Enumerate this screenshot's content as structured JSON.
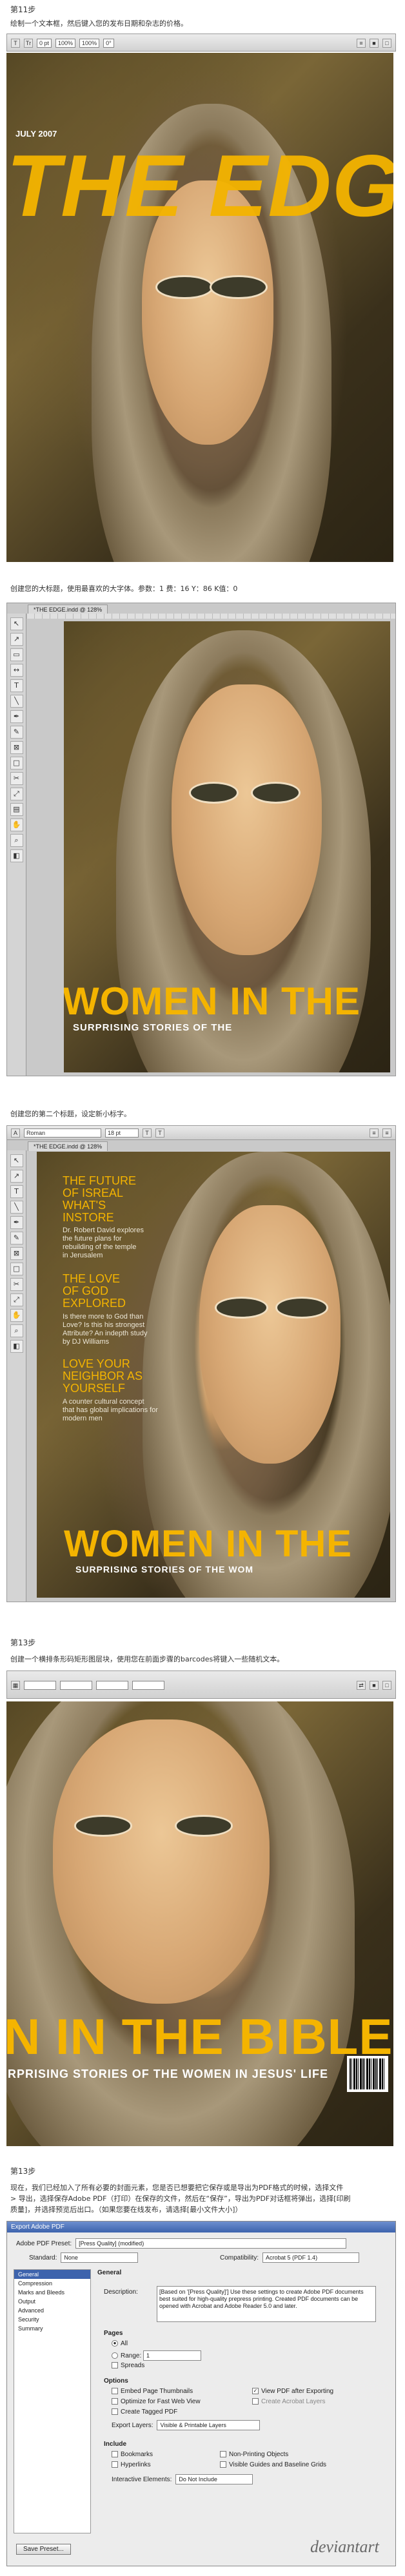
{
  "step11": {
    "heading": "第11步",
    "caption": "绘制一个文本框，然后键入您的发布日期和杂志的价格。",
    "cover_small_text": "JULY 2007",
    "cover_title": "THE EDGE",
    "toolbar": [
      "T",
      "Tr",
      "0 pt",
      "100%",
      "100%",
      "0°"
    ]
  },
  "step12": {
    "caption": "创建您的大标题，使用最喜欢的大字体。参数：1 费：16 Y：86 K值：0",
    "tab": "*THE EDGE.indd @ 128%",
    "title": "WOMEN IN THE",
    "subtitle": "SURPRISING STORIES OF THE"
  },
  "step13": {
    "caption": "创建您的第二个标题，设定新小标字。",
    "tab": "*THE EDGE.indd @ 128%",
    "font": "Roman",
    "size": "18 pt",
    "headline1": [
      "THE FUTURE",
      "OF ISREAL",
      "WHAT'S",
      "INSTORE"
    ],
    "body1": [
      "Dr. Robert David explores",
      "the future plans for",
      "rebuilding of the temple",
      "in Jerusalem"
    ],
    "headline2": [
      "THE LOVE",
      "OF GOD",
      "EXPLORED"
    ],
    "body2": [
      "Is there more to God than",
      "Love? Is this his strongest",
      "Attribute? An indepth study",
      "by DJ Williams"
    ],
    "headline3": [
      "LOVE YOUR",
      "NEIGHBOR AS",
      "YOURSELF"
    ],
    "body3": [
      "A counter cultural concept",
      "that has global implications for",
      "modern men"
    ],
    "title": "WOMEN IN THE",
    "subtitle": "SURPRISING STORIES OF THE WOM"
  },
  "step14": {
    "heading": "第13步",
    "caption": "创建一个横排条形码矩形图层块，使用您在前面步骤的barcodes将键入一些随机文本。",
    "title": "N IN THE BIBLE",
    "subtitle": "RPRISING STORIES OF THE WOMEN IN JESUS' LIFE"
  },
  "step15": {
    "heading": "第13步",
    "caption_lines": [
      "现在，我们已经加入了所有必要的封面元素，您是否已想要把它保存或是导出为PDF格式的时候，选择文件",
      "> 导出，选择保存Adobe PDF（打印）在保存的文件，然后在“保存”，导出为PDF对话框将弹出，选择[印刷",
      "质量]，并选择预览后出口。（如果您要在线发布，请选择[最小文件大小]）"
    ],
    "dialog_title": "Export Adobe PDF",
    "preset_label": "Adobe PDF Preset:",
    "preset_value": "[Press Quality] (modified)",
    "standard_label": "Standard:",
    "standard_value": "None",
    "compat_label": "Compatibility:",
    "compat_value": "Acrobat 5 (PDF 1.4)",
    "categories": [
      "General",
      "Compression",
      "Marks and Bleeds",
      "Output",
      "Advanced",
      "Security",
      "Summary"
    ],
    "section_title": "General",
    "desc_label": "Description:",
    "desc_text": "[Based on '[Press Quality]'] Use these settings to create Adobe PDF documents best suited for high-quality prepress printing.  Created PDF documents can be opened with Acrobat and Adobe Reader 5.0 and later.",
    "pages_label": "Pages",
    "pages_all": "All",
    "pages_range": "Range:",
    "pages_range_value": "1",
    "pages_spreads": "Spreads",
    "options_label": "Options",
    "opt_embed": "Embed Page Thumbnails",
    "opt_optimize": "Optimize for Fast Web View",
    "opt_tagged": "Create Tagged PDF",
    "opt_view": "View PDF after Exporting",
    "opt_layers": "Create Acrobat Layers",
    "export_layers_label": "Export Layers:",
    "export_layers_value": "Visible & Printable Layers",
    "include_label": "Include",
    "inc_bookmarks": "Bookmarks",
    "inc_hyperlinks": "Hyperlinks",
    "inc_nonprinting": "Non-Printing Objects",
    "inc_guides": "Visible Guides and Baseline Grids",
    "interactive_label": "Interactive Elements:",
    "interactive_value": "Do Not Include",
    "save_preset": "Save Preset..."
  },
  "watermark": "deviantart"
}
